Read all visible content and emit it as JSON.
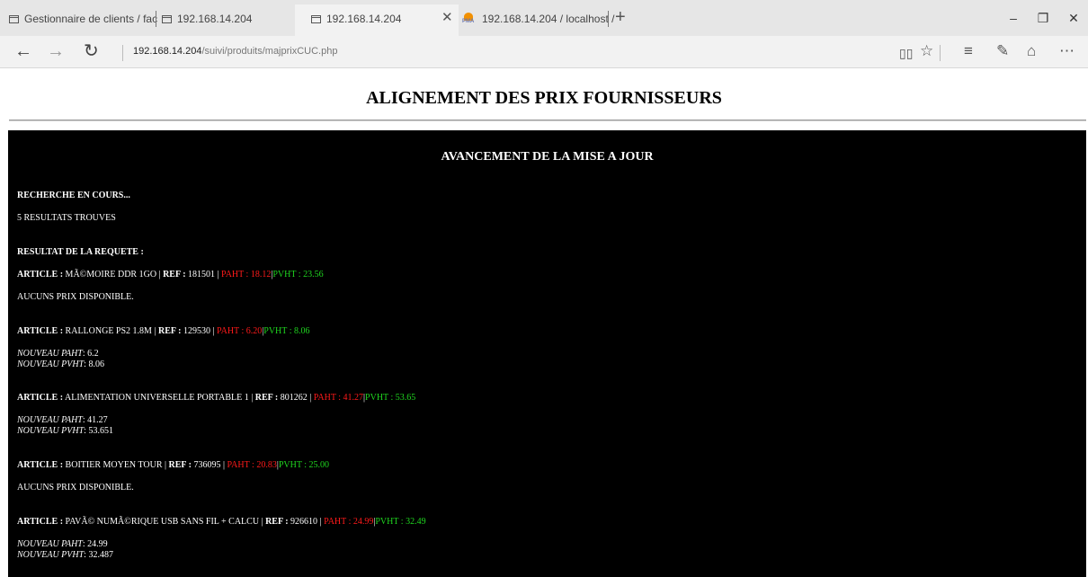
{
  "browser": {
    "tabs": [
      {
        "label": "Gestionnaire de clients / fac"
      },
      {
        "label": "192.168.14.204"
      },
      {
        "label": "192.168.14.204",
        "active": true
      },
      {
        "label": "192.168.14.204 / localhost /"
      }
    ],
    "url_host": "192.168.14.204",
    "url_path": "/suivi/produits/majprixCUC.php",
    "pma_badge": "PMA"
  },
  "page": {
    "title": "ALIGNEMENT DES PRIX FOURNISSEURS",
    "panel_title": "AVANCEMENT DE LA MISE A JOUR",
    "searching": "RECHERCHE EN COURS...",
    "found": "5 RESULTATS TROUVES",
    "result_heading": "RESULTAT DE LA REQUETE :",
    "labels": {
      "article": "ARTICLE :",
      "ref": "REF :",
      "paht": "PAHT :",
      "pvht": "PVHT :",
      "sep": "|",
      "new_paht": "NOUVEAU PAHT",
      "new_pvht": "NOUVEAU PVHT",
      "colon": ":"
    },
    "articles": [
      {
        "name": "MÃ©MOIRE DDR 1GO",
        "ref": "181501",
        "paht": "18.12",
        "pvht": "23.56",
        "status": "AUCUNS PRIX DISPONIBLE."
      },
      {
        "name": "RALLONGE PS2 1.8M",
        "ref": "129530",
        "paht": "6.20",
        "pvht": "8.06",
        "new_paht": "6.2",
        "new_pvht": "8.06"
      },
      {
        "name": "ALIMENTATION UNIVERSELLE PORTABLE 1",
        "ref": "801262",
        "paht": "41.27",
        "pvht": "53.65",
        "new_paht": "41.27",
        "new_pvht": "53.651"
      },
      {
        "name": "BOITIER MOYEN TOUR",
        "ref": "736095",
        "paht": "20.83",
        "pvht": "25.00",
        "status": "AUCUNS PRIX DISPONIBLE."
      },
      {
        "name": "PAVÃ© NUMÃ©RIQUE USB SANS FIL + CALCU",
        "ref": "926610",
        "paht": "24.99",
        "pvht": "32.49",
        "new_paht": "24.99",
        "new_pvht": "32.487"
      }
    ]
  }
}
